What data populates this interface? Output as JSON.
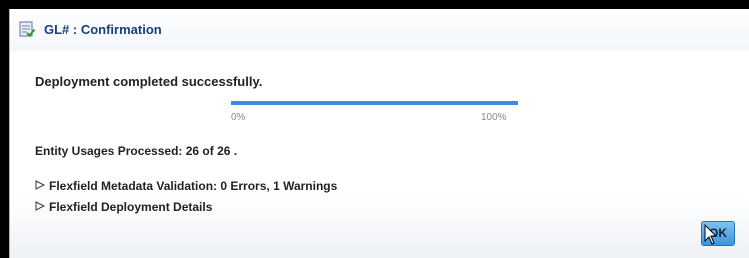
{
  "dialog": {
    "title": "GL# : Confirmation",
    "icon": "document-check-icon"
  },
  "message": "Deployment completed successfully.",
  "progress": {
    "value": 1.0,
    "min_label": "0%",
    "max_label": "100%"
  },
  "entity_usages": "Entity Usages Processed: 26 of 26 .",
  "disclosures": [
    {
      "icon": "triangle-right-icon",
      "label": "Flexfield Metadata Validation: 0 Errors, 1 Warnings"
    },
    {
      "icon": "triangle-right-icon",
      "label": "Flexfield Deployment Details"
    }
  ],
  "buttons": {
    "ok": "OK"
  },
  "colors": {
    "title_text": "#1b3f7a",
    "progress_fill": "#3b8bea",
    "ok_button": "#3d94dd"
  }
}
